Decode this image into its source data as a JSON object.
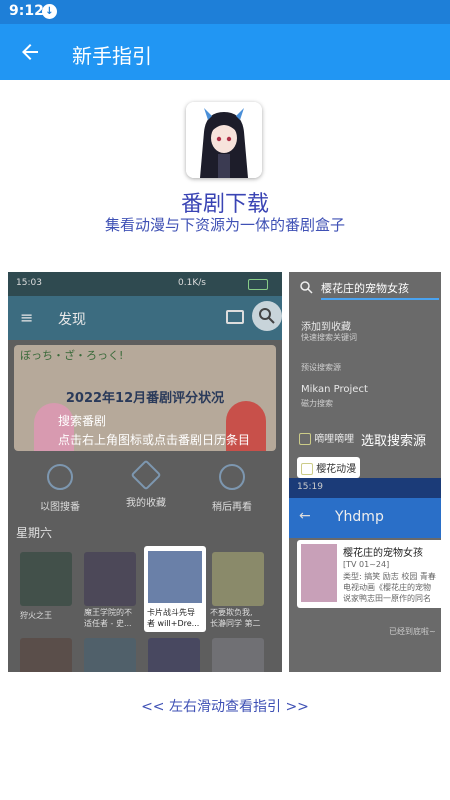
{
  "status_bar": {
    "time": "9:12",
    "download_icon": "download-icon"
  },
  "app_bar": {
    "title": "新手指引",
    "back_icon": "arrow-back-icon"
  },
  "app": {
    "name": "番剧下载",
    "description": "集看动漫与下资源为一体的番剧盒子"
  },
  "left_screenshot": {
    "status": {
      "time": "15:03",
      "right": "0.1K/s"
    },
    "header": {
      "title": "发现",
      "cast_icon": "cast-icon",
      "search_icon": "search-icon",
      "menu_icon": "menu-icon"
    },
    "banner": {
      "logo_text": "ぼっち・ざ・ろっく!",
      "title": "2022年12月番剧评分状况"
    },
    "guide": {
      "line1": "搜索番剧",
      "line2": "点击右上角图标或点击番剧日历条目"
    },
    "quick_actions": [
      {
        "label": "以图搜番",
        "icon": "image-search-icon"
      },
      {
        "label": "我的收藏",
        "icon": "star-icon"
      },
      {
        "label": "稍后再看",
        "icon": "history-icon"
      }
    ],
    "section": "星期六",
    "thumbnails": [
      {
        "caption1": "狩火之王",
        "caption2": ""
      },
      {
        "caption1": "魔王学院的不",
        "caption2": "适任者 - 史..."
      },
      {
        "caption1": "卡片战斗先导",
        "caption2": "者 will+Dre..."
      },
      {
        "caption1": "不要欺负我,",
        "caption2": "长瀞同学 第二"
      }
    ]
  },
  "right_screenshot": {
    "search_value": "樱花庄的宠物女孩",
    "add_favorite": {
      "title": "添加到收藏",
      "sub": "快速搜索关键词"
    },
    "preset_label": "预设搜索源",
    "source_mikan": {
      "title": "Mikan Project",
      "sub": "磁力搜索"
    },
    "source_dilili": "嘀哩嘀哩",
    "select_hint": "选取搜索源",
    "source_yinghua": "樱花动漫",
    "inner_status_time": "15:19",
    "inner_title": "Yhdmp",
    "result": {
      "title": "樱花庄的宠物女孩",
      "episodes": "[TV 01~24]",
      "type": "类型: 搞笑 励志 校园 青春",
      "desc1": "电视动画《樱花庄的宠物",
      "desc2": "说家鸭志田一原作的同名"
    },
    "end_text": "已经到底啦~"
  },
  "swipe_hint": "<< 左右滑动查看指引 >>"
}
